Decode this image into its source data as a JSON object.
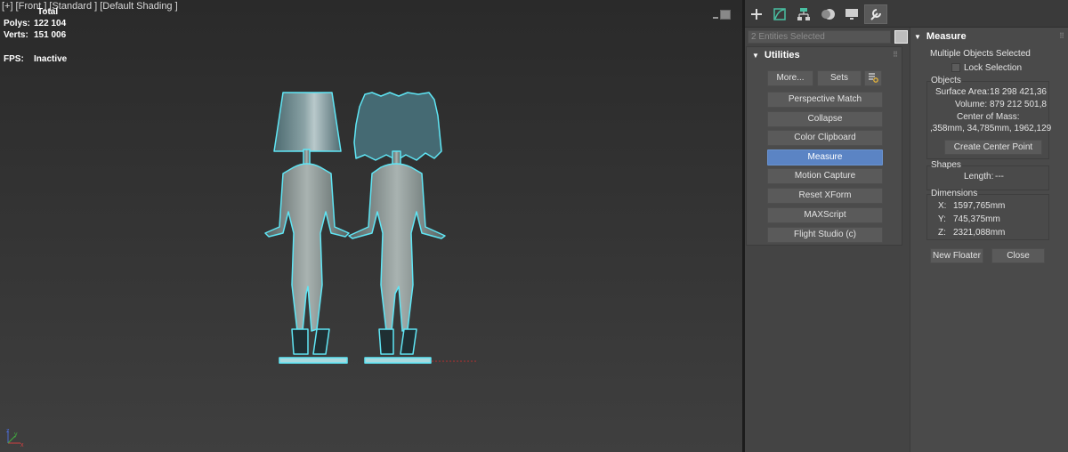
{
  "viewport": {
    "label_parts": [
      "[+]",
      "[Front ]",
      "[Standard ]",
      "[Default Shading ]"
    ],
    "stats": {
      "total_label": "Total",
      "polys_label": "Polys:",
      "polys_value": "122 104",
      "verts_label": "Verts:",
      "verts_value": "151 006",
      "fps_label": "FPS:",
      "fps_value": "Inactive"
    },
    "gizmo": {
      "x": "x",
      "y": "y",
      "z": "z"
    },
    "selection_color": "#5fe6f5"
  },
  "command_panel": {
    "tabs": [
      {
        "icon": "create-icon"
      },
      {
        "icon": "modify-icon"
      },
      {
        "icon": "hierarchy-icon"
      },
      {
        "icon": "motion-icon"
      },
      {
        "icon": "display-icon"
      },
      {
        "icon": "utilities-icon",
        "active": true
      }
    ],
    "entity_field": "2 Entities Selected",
    "utilities": {
      "title": "Utilities",
      "more": "More...",
      "sets": "Sets",
      "buttons": [
        "Perspective Match",
        "Collapse",
        "Color Clipboard",
        "Measure",
        "Motion Capture",
        "Reset XForm",
        "MAXScript",
        "Flight Studio (c)"
      ],
      "active_button": "Measure",
      "active_color": "#5b84c4"
    },
    "measure": {
      "title": "Measure",
      "selection_status": "Multiple Objects Selected",
      "lock_selection": "Lock Selection",
      "objects_title": "Objects",
      "surface_area_label": "Surface Area:",
      "surface_area_value": "18 298 421,36",
      "volume_label": "Volume:",
      "volume_value": "879 212 501,8",
      "center_of_mass_label": "Center of Mass:",
      "center_of_mass_value": ",358mm, 34,785mm, 1962,129",
      "create_center_point": "Create Center Point",
      "shapes_title": "Shapes",
      "length_label": "Length:",
      "length_value": "---",
      "dimensions_title": "Dimensions",
      "dim_x_label": "X:",
      "dim_x_value": "1597,765mm",
      "dim_y_label": "Y:",
      "dim_y_value": "745,375mm",
      "dim_z_label": "Z:",
      "dim_z_value": "2321,088mm",
      "new_floater": "New Floater",
      "close": "Close"
    }
  }
}
